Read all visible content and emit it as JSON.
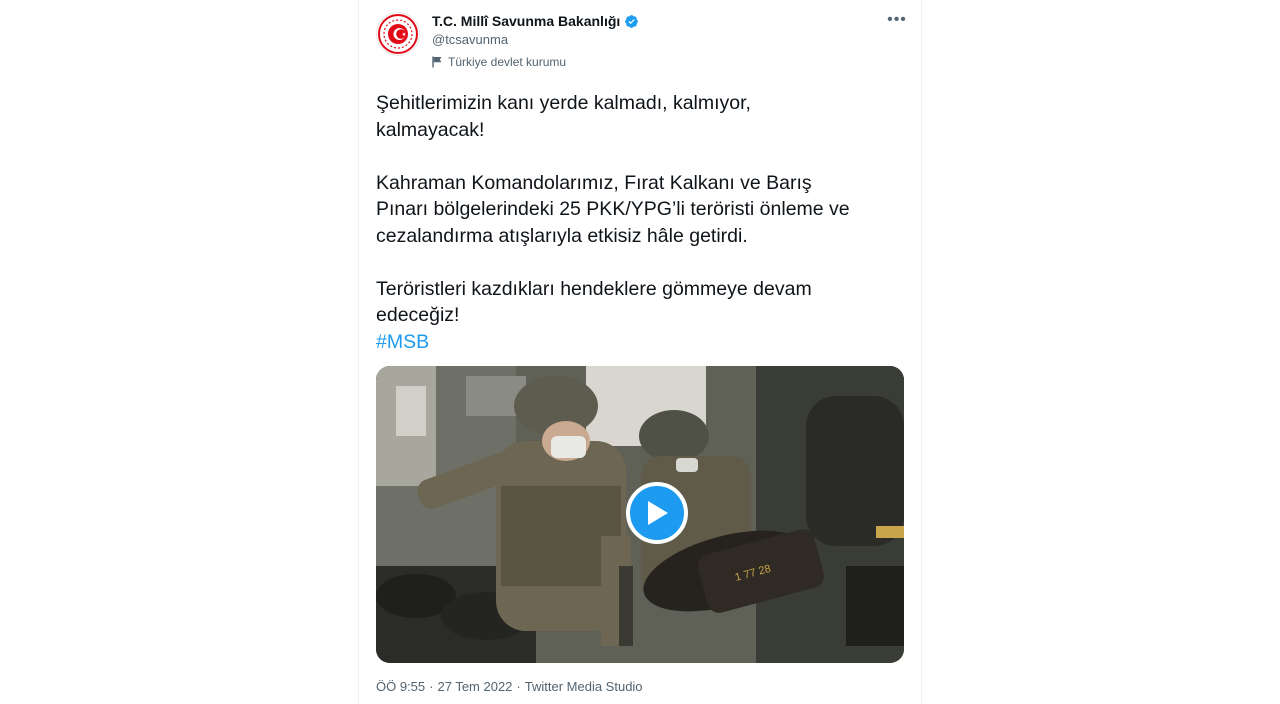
{
  "tweet": {
    "author": {
      "name": "T.C. Millî Savunma Bakanlığı",
      "handle": "@tcsavunma",
      "label": "Türkiye devlet kurumu",
      "verified_icon": "verified-badge-icon",
      "avatar_icon": "msb-emblem-logo"
    },
    "more_icon": "more-dots-icon",
    "text": {
      "p1_line1": "Şehitlerimizin kanı yerde kalmadı, kalmıyor,",
      "p1_line2": "kalmayacak!",
      "p2_line1": "Kahraman Komandolarımız, Fırat Kalkanı ve Barış",
      "p2_line2": "Pınarı bölgelerindeki  25 PKK/YPG’li teröristi önleme ve",
      "p2_line3": "cezalandırma atışlarıyla etkisiz hâle getirdi.",
      "p3_line1": "Teröristleri kazdıkları hendeklere gömmeye devam",
      "p3_line2": "edeceğiz!",
      "hashtag": "#MSB"
    },
    "media": {
      "type": "video",
      "play_icon": "play-icon"
    },
    "meta": {
      "time": "ÖÖ 9:55",
      "sep1": "·",
      "date": "27 Tem 2022",
      "sep2": "·",
      "source": "Twitter Media Studio"
    }
  },
  "colors": {
    "accent": "#1d9bf0",
    "text": "#0f1419",
    "secondary": "#536471",
    "emblem_red": "#e30a17"
  }
}
